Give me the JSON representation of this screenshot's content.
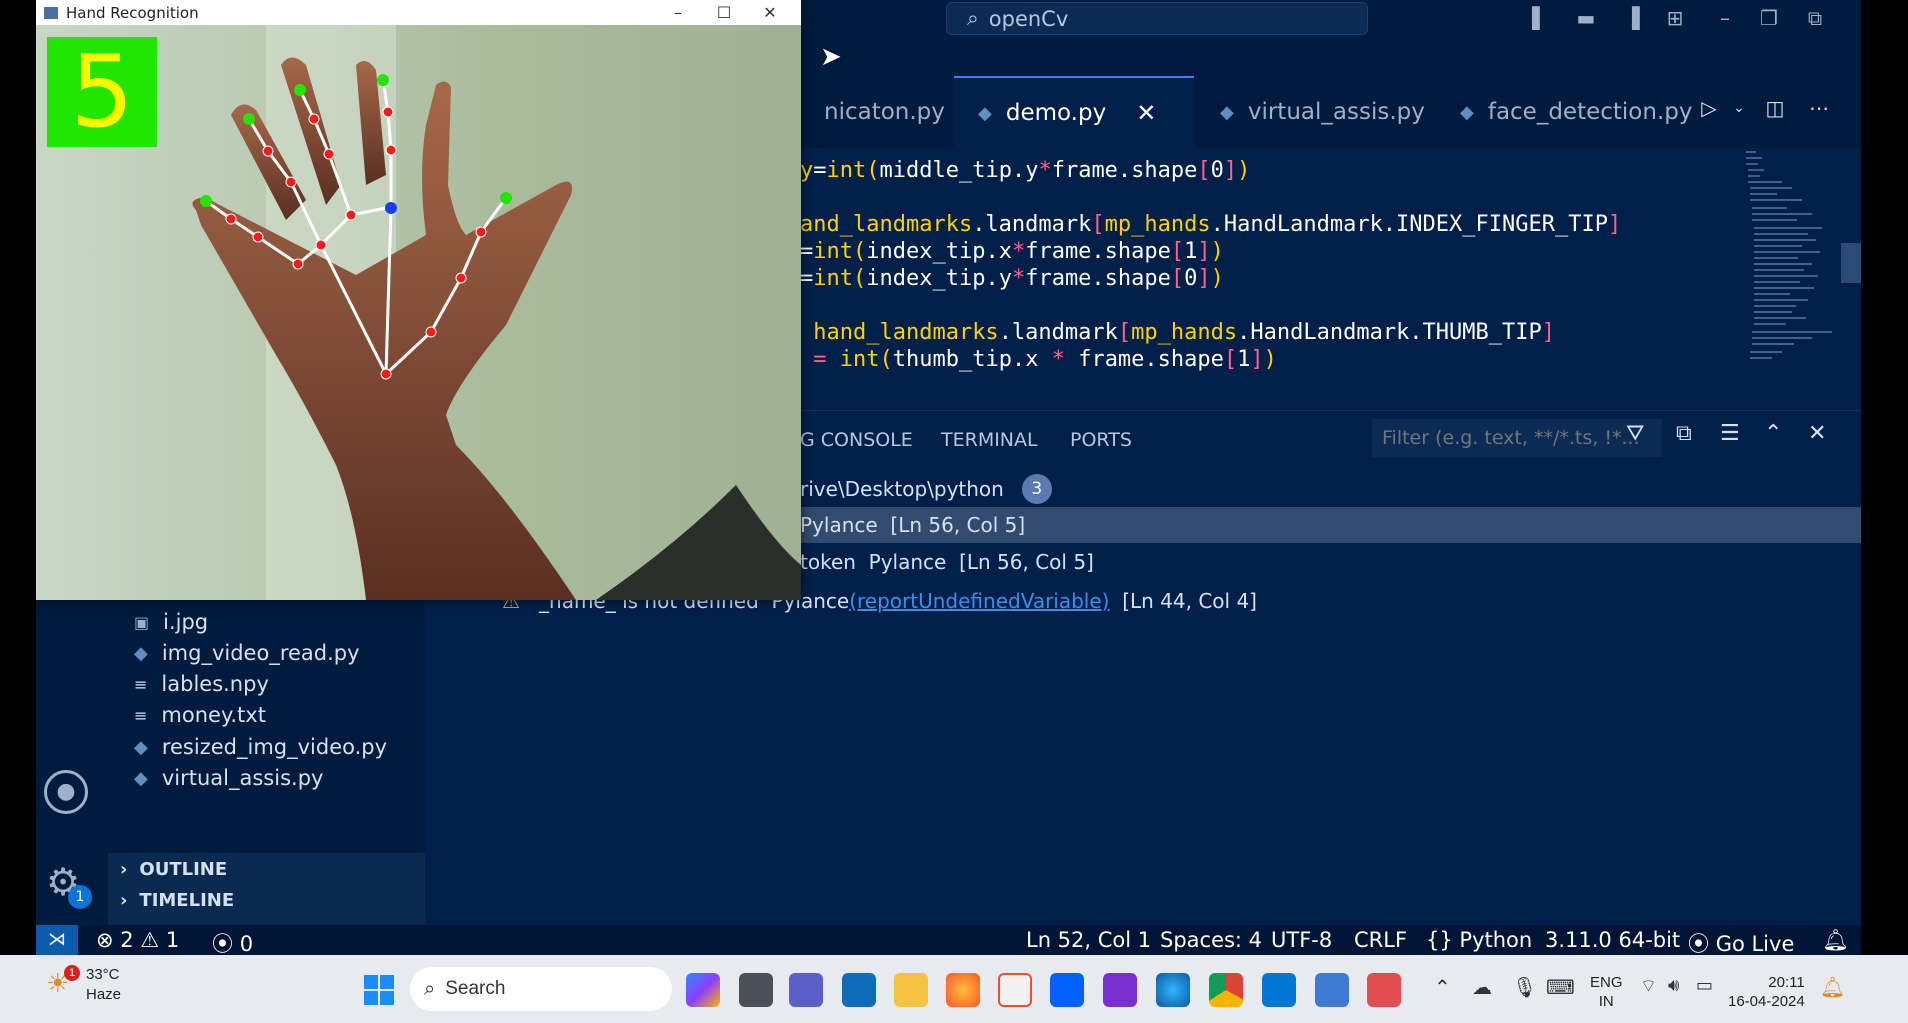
{
  "cv_window": {
    "title": "Hand Recognition",
    "finger_count": "5",
    "count_bg": "#22e600",
    "count_fg": "#f7f700"
  },
  "vscode": {
    "command_center": "openCv",
    "tabs": [
      {
        "label": "nicaton.py",
        "active": false
      },
      {
        "label": "demo.py",
        "active": true
      },
      {
        "label": "virtual_assis.py",
        "active": false
      },
      {
        "label": "face_detection.py",
        "active": false
      }
    ],
    "code_lines": [
      "y=int(middle_tip.y*frame.shape[0])",
      "",
      "and_landmarks.landmark[mp_hands.HandLandmark.INDEX_FINGER_TIP]",
      "=int(index_tip.x*frame.shape[1])",
      "=int(index_tip.y*frame.shape[0])",
      "",
      " hand_landmarks.landmark[mp_hands.HandLandmark.THUMB_TIP]",
      " = int(thumb_tip.x * frame.shape[1])"
    ],
    "panel": {
      "tabs": [
        "G CONSOLE",
        "TERMINAL",
        "PORTS"
      ],
      "filter_placeholder": "Filter (e.g. text, **/*.ts, !*...",
      "folder": "rive\\Desktop\\python",
      "folder_count": "3",
      "problems": [
        {
          "prefix": "",
          "source": "Pylance",
          "location": "[Ln 56, Col 5]",
          "selected": true
        },
        {
          "prefix": "token",
          "source": "Pylance",
          "location": "[Ln 56, Col 5]",
          "selected": false
        },
        {
          "prefix": "_name_ is not defined",
          "source": "Pylance",
          "link": "(reportUndefinedVariable)",
          "location": "[Ln 44, Col 4]",
          "selected": false
        }
      ]
    },
    "explorer": {
      "files": [
        {
          "name": "i.jpg",
          "icon": "image-icon"
        },
        {
          "name": "img_video_read.py",
          "icon": "python-icon"
        },
        {
          "name": "lables.npy",
          "icon": "file-lines-icon"
        },
        {
          "name": "money.txt",
          "icon": "file-lines-icon"
        },
        {
          "name": "resized_img_video.py",
          "icon": "python-icon"
        },
        {
          "name": "virtual_assis.py",
          "icon": "python-icon"
        }
      ],
      "sections": [
        "OUTLINE",
        "TIMELINE"
      ]
    },
    "settings_badge": "1",
    "status": {
      "errors": "2",
      "warnings": "1",
      "ports": "0",
      "position": "Ln 52, Col 1",
      "spaces": "Spaces: 4",
      "encoding": "UTF-8",
      "eol": "CRLF",
      "language": "Python",
      "interpreter": "3.11.0 64-bit",
      "live": "Go Live"
    }
  },
  "taskbar": {
    "weather_temp": "33°C",
    "weather_desc": "Haze",
    "weather_badge": "1",
    "search_label": "Search",
    "lang_top": "ENG",
    "lang_bottom": "IN",
    "time": "20:11",
    "date": "16-04-2024"
  }
}
